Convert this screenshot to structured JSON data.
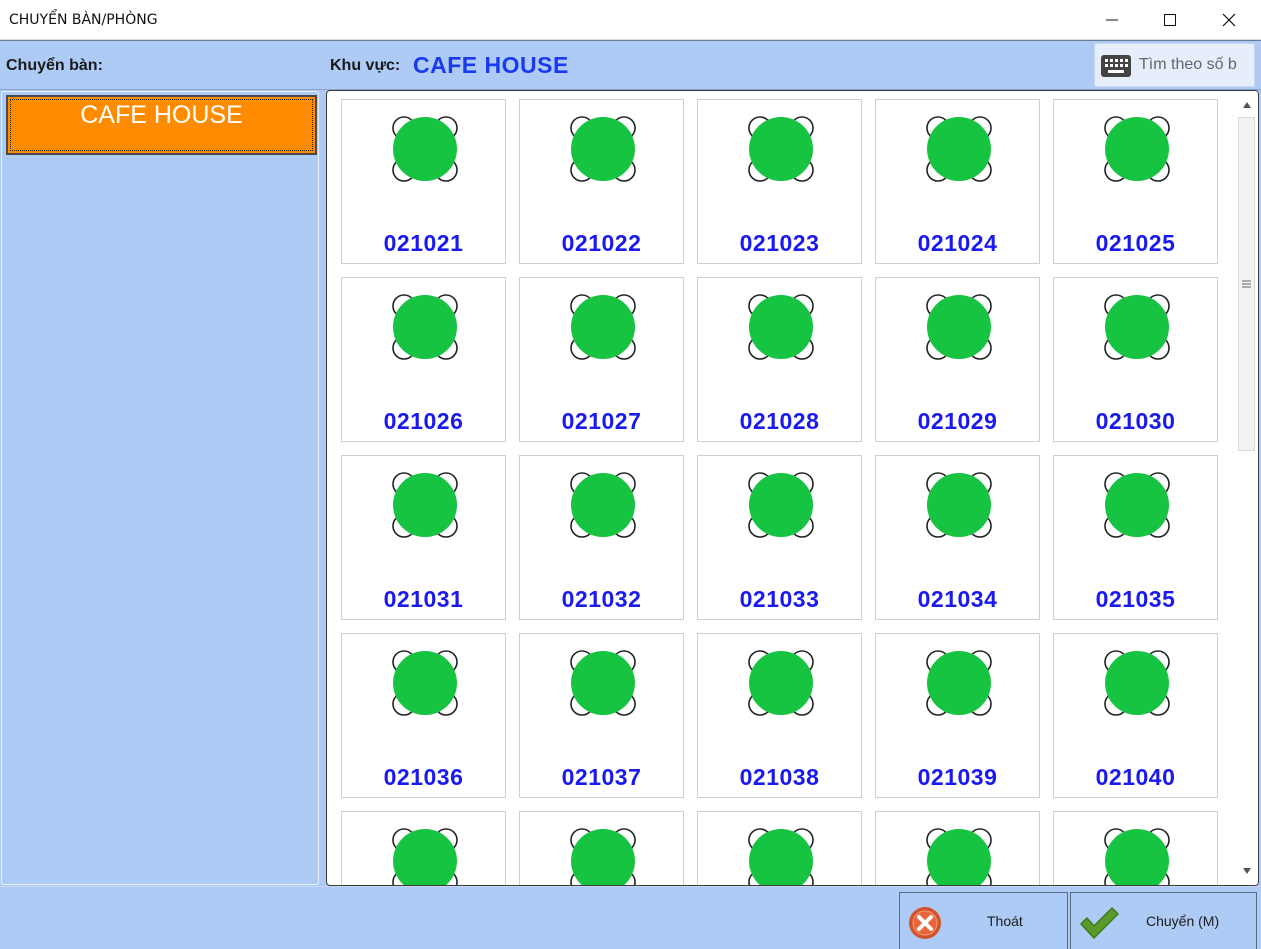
{
  "window": {
    "title": "CHUYỂN BÀN/PHÒNG"
  },
  "header": {
    "transfer_label": "Chuyển bàn:",
    "area_label": "Khu vực:",
    "area_value": "CAFE HOUSE",
    "search_placeholder": "Tìm theo số b"
  },
  "zones": [
    {
      "label": "CAFE HOUSE",
      "selected": true,
      "color": "#ff8c00"
    }
  ],
  "tables": [
    "021021",
    "021022",
    "021023",
    "021024",
    "021025",
    "021026",
    "021027",
    "021028",
    "021029",
    "021030",
    "021031",
    "021032",
    "021033",
    "021034",
    "021035",
    "021036",
    "021037",
    "021038",
    "021039",
    "021040",
    "",
    "",
    "",
    "",
    ""
  ],
  "table_status_color": "#16c442",
  "footer": {
    "exit_label": "Thoát",
    "transfer_label": "Chuyển (M)"
  },
  "icons": {
    "table": "round-table-icon",
    "keyboard": "keyboard-icon",
    "exit": "cancel-x-icon",
    "transfer": "checkmark-icon"
  }
}
